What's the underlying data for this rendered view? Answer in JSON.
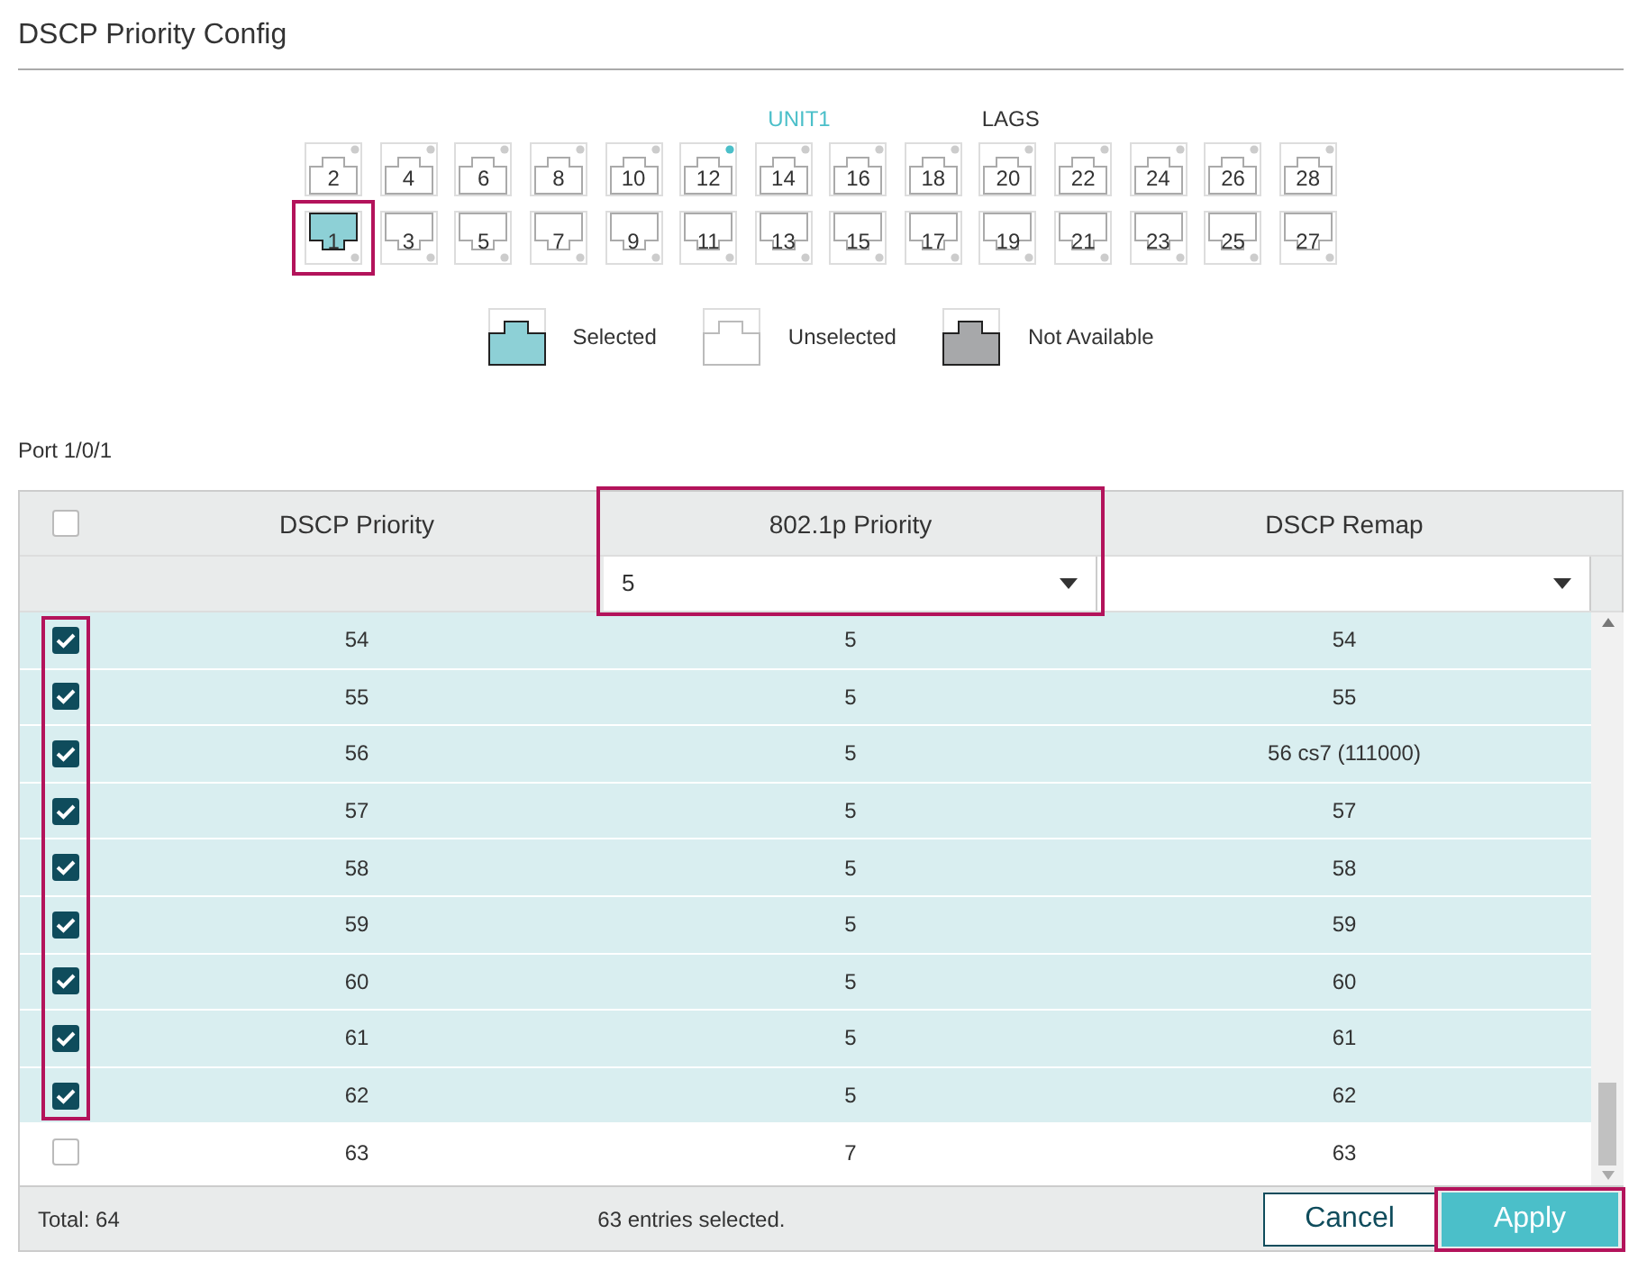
{
  "title": "DSCP Priority Config",
  "unit_tabs": [
    {
      "label": "UNIT1",
      "selected": true
    },
    {
      "label": "LAGS",
      "selected": false
    }
  ],
  "port_rows": [
    {
      "kind": "upper",
      "ports": [
        {
          "label": "2",
          "selected": false,
          "linked": false
        },
        {
          "label": "4",
          "selected": false,
          "linked": false
        },
        {
          "label": "6",
          "selected": false,
          "linked": false
        },
        {
          "label": "8",
          "selected": false,
          "linked": false
        },
        {
          "label": "10",
          "selected": false,
          "linked": false
        },
        {
          "label": "12",
          "selected": false,
          "linked": true
        },
        {
          "label": "14",
          "selected": false,
          "linked": false
        },
        {
          "label": "16",
          "selected": false,
          "linked": false
        },
        {
          "label": "18",
          "selected": false,
          "linked": false
        },
        {
          "label": "20",
          "selected": false,
          "linked": false
        },
        {
          "label": "22",
          "selected": false,
          "linked": false
        },
        {
          "label": "24",
          "selected": false,
          "linked": false
        },
        {
          "label": "26",
          "selected": false,
          "linked": false
        },
        {
          "label": "28",
          "selected": false,
          "linked": false
        }
      ]
    },
    {
      "kind": "lower",
      "ports": [
        {
          "label": "1",
          "selected": true,
          "linked": false,
          "highlighted": true
        },
        {
          "label": "3",
          "selected": false,
          "linked": false
        },
        {
          "label": "5",
          "selected": false,
          "linked": false
        },
        {
          "label": "7",
          "selected": false,
          "linked": false
        },
        {
          "label": "9",
          "selected": false,
          "linked": false
        },
        {
          "label": "11",
          "selected": false,
          "linked": false
        },
        {
          "label": "13",
          "selected": false,
          "linked": false
        },
        {
          "label": "15",
          "selected": false,
          "linked": false
        },
        {
          "label": "17",
          "selected": false,
          "linked": false
        },
        {
          "label": "19",
          "selected": false,
          "linked": false
        },
        {
          "label": "21",
          "selected": false,
          "linked": false
        },
        {
          "label": "23",
          "selected": false,
          "linked": false
        },
        {
          "label": "25",
          "selected": false,
          "linked": false
        },
        {
          "label": "27",
          "selected": false,
          "linked": false
        }
      ]
    }
  ],
  "legend": [
    {
      "kind": "selected",
      "label": "Selected"
    },
    {
      "kind": "unselected",
      "label": "Unselected"
    },
    {
      "kind": "unavailable",
      "label": "Not Available"
    }
  ],
  "port_label": "Port 1/0/1",
  "table": {
    "header_checked": false,
    "columns": [
      {
        "label": "DSCP Priority",
        "highlighted": false
      },
      {
        "label": "802.1p Priority",
        "highlighted": true
      },
      {
        "label": "DSCP Remap",
        "highlighted": false
      }
    ],
    "filters": [
      {
        "kind": "blank"
      },
      {
        "kind": "select",
        "value": "5"
      },
      {
        "kind": "select"
      }
    ],
    "checked_boxes_highlighted": true,
    "rows": [
      {
        "checked": true,
        "cells": [
          "54",
          "5",
          "54"
        ]
      },
      {
        "checked": true,
        "cells": [
          "55",
          "5",
          "55"
        ]
      },
      {
        "checked": true,
        "cells": [
          "56",
          "5",
          "56 cs7 (111000)"
        ]
      },
      {
        "checked": true,
        "cells": [
          "57",
          "5",
          "57"
        ]
      },
      {
        "checked": true,
        "cells": [
          "58",
          "5",
          "58"
        ]
      },
      {
        "checked": true,
        "cells": [
          "59",
          "5",
          "59"
        ]
      },
      {
        "checked": true,
        "cells": [
          "60",
          "5",
          "60"
        ]
      },
      {
        "checked": true,
        "cells": [
          "61",
          "5",
          "61"
        ]
      },
      {
        "checked": true,
        "cells": [
          "62",
          "5",
          "62"
        ]
      },
      {
        "checked": false,
        "cells": [
          "63",
          "7",
          "63"
        ]
      }
    ],
    "total": "Total: 64",
    "selection_info": "63 entries selected."
  },
  "buttons": [
    {
      "kind": "secondary",
      "label": "Cancel",
      "highlighted": false
    },
    {
      "kind": "primary",
      "label": "Apply",
      "highlighted": true
    }
  ]
}
